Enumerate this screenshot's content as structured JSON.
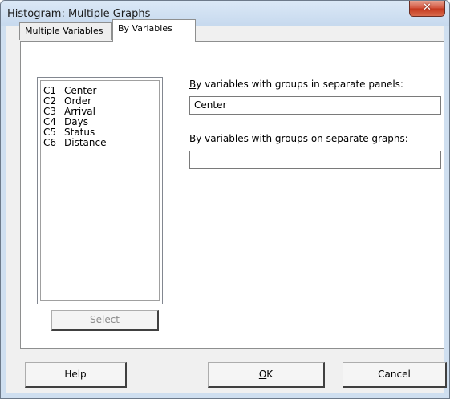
{
  "window": {
    "title": "Histogram: Multiple Graphs",
    "close_symbol": "✕"
  },
  "tabs": [
    {
      "label": "Multiple Variables",
      "active": false
    },
    {
      "label": "By Variables",
      "active": true
    }
  ],
  "variables": [
    {
      "id": "C1",
      "name": "Center"
    },
    {
      "id": "C2",
      "name": "Order"
    },
    {
      "id": "C3",
      "name": "Arrival"
    },
    {
      "id": "C4",
      "name": "Days"
    },
    {
      "id": "C5",
      "name": "Status"
    },
    {
      "id": "C6",
      "name": "Distance"
    }
  ],
  "select_button": {
    "label": "Select",
    "enabled": false
  },
  "by_panels": {
    "label_mnemonic": "B",
    "label_rest": "y variables with groups in separate panels:",
    "value": "Center"
  },
  "by_graphs": {
    "label_prefix": "By ",
    "label_mnemonic": "v",
    "label_rest": "ariables with groups on separate graphs:",
    "value": ""
  },
  "buttons": {
    "help": "Help",
    "ok_mnemonic": "O",
    "ok_rest": "K",
    "cancel": "Cancel"
  },
  "colors": {
    "frame": "#cfdff0",
    "close_button": "#c4381e",
    "panel": "#ffffff",
    "face": "#f0f0f0"
  }
}
